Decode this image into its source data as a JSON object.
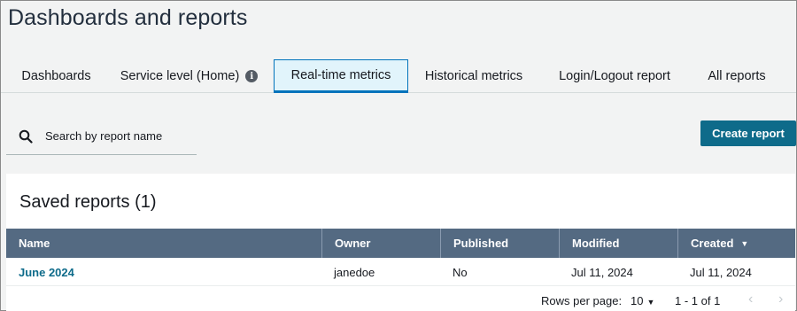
{
  "page": {
    "title": "Dashboards and reports"
  },
  "tabs": [
    {
      "label": "Dashboards"
    },
    {
      "label": "Service level (Home)",
      "info_icon": "i"
    },
    {
      "label": "Real-time metrics",
      "active": true
    },
    {
      "label": "Historical metrics"
    },
    {
      "label": "Login/Logout report"
    },
    {
      "label": "All reports"
    }
  ],
  "search": {
    "placeholder": "Search by report name",
    "value": "",
    "icon": "search-icon"
  },
  "create_button": {
    "label": "Create report"
  },
  "saved_reports": {
    "title": "Saved reports (1)",
    "columns": [
      "Name",
      "Owner",
      "Published",
      "Modified",
      "Created"
    ],
    "sort_column": "Created",
    "sort_icon": "▼",
    "rows": [
      {
        "name": "June 2024",
        "owner": "janedoe",
        "published": "No",
        "modified": "Jul 11, 2024",
        "created": "Jul 11, 2024"
      }
    ]
  },
  "pagination": {
    "rows_per_page_label": "Rows per page:",
    "rows_per_page_value": "10",
    "caret": "▼",
    "range": "1 - 1 of 1",
    "prev": "‹",
    "next": "›"
  },
  "colors": {
    "accent": "#0073bb",
    "button": "#0e6b8a",
    "table_header": "#546a82",
    "active_tab_bg": "#e1f4fb"
  }
}
